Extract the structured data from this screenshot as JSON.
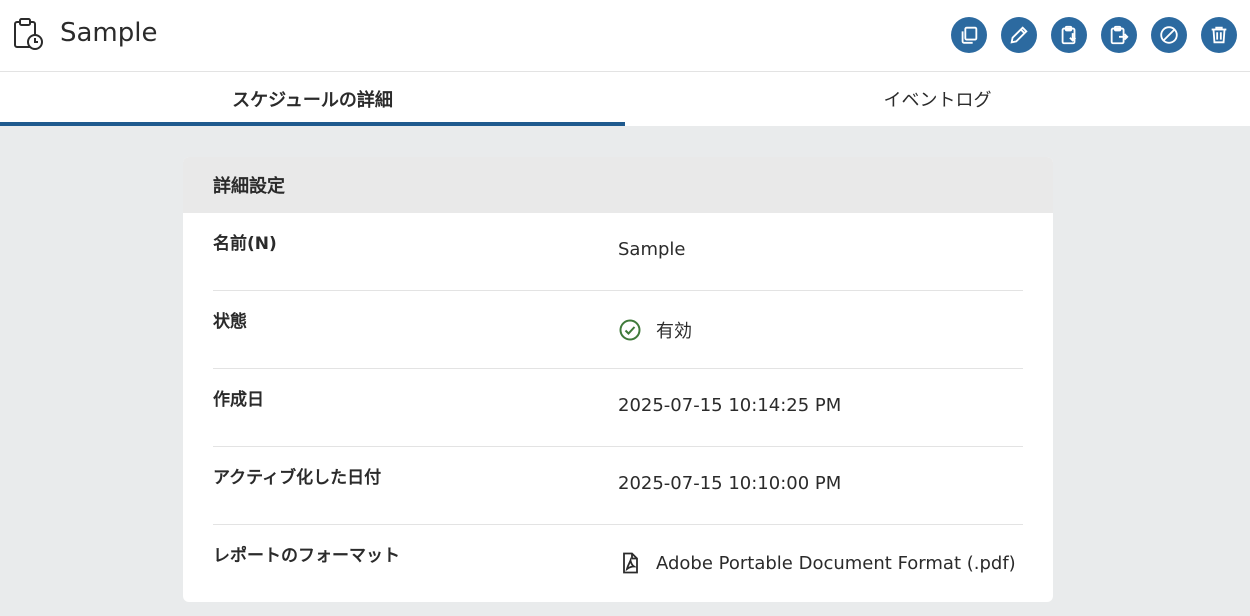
{
  "header": {
    "title": "Sample",
    "title_icon": "clipboard-clock-icon",
    "actions": [
      {
        "name": "copy-icon"
      },
      {
        "name": "edit-icon"
      },
      {
        "name": "clipboard-import-icon"
      },
      {
        "name": "clipboard-export-icon"
      },
      {
        "name": "disable-icon"
      },
      {
        "name": "trash-icon"
      }
    ],
    "accent": "#2c6aa0"
  },
  "tabs": [
    {
      "label": "スケジュールの詳細",
      "active": true
    },
    {
      "label": "イベントログ",
      "active": false
    }
  ],
  "card": {
    "title": "詳細設定",
    "rows": [
      {
        "label": "名前(N)",
        "value": "Sample"
      },
      {
        "label": "状態",
        "value": "有効",
        "icon": "check-circle-icon",
        "icon_color": "#3f7a3a"
      },
      {
        "label": "作成日",
        "value": "2025-07-15 10:14:25 PM"
      },
      {
        "label": "アクティブ化した日付",
        "value": "2025-07-15 10:10:00 PM"
      },
      {
        "label": "レポートのフォーマット",
        "value": "Adobe Portable Document Format (.pdf)",
        "icon": "pdf-file-icon"
      }
    ]
  }
}
